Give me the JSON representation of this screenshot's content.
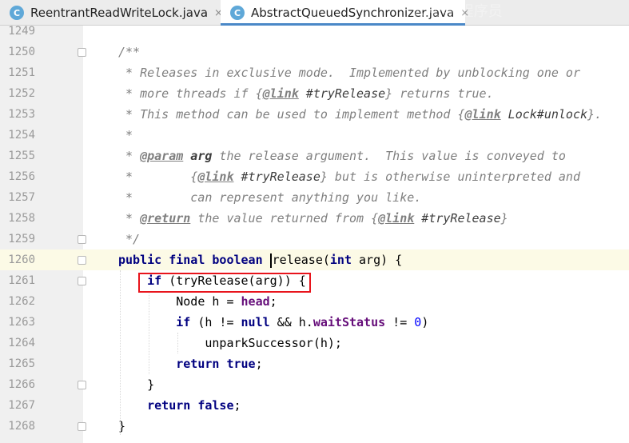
{
  "tabs": [
    {
      "icon": "C",
      "label": "ReentrantReadWriteLock.java",
      "close": "×"
    },
    {
      "icon": "C",
      "label": "AbstractQueuedSynchronizer.java",
      "close": "×"
    }
  ],
  "lines": {
    "n1249": "1249",
    "n1250": "1250",
    "n1251": "1251",
    "n1252": "1252",
    "n1253": "1253",
    "n1254": "1254",
    "n1255": "1255",
    "n1256": "1256",
    "n1257": "1257",
    "n1258": "1258",
    "n1259": "1259",
    "n1260": "1260",
    "n1261": "1261",
    "n1262": "1262",
    "n1263": "1263",
    "n1264": "1264",
    "n1265": "1265",
    "n1266": "1266",
    "n1267": "1267",
    "n1268": "1268"
  },
  "code": {
    "l1250": "/**",
    "l1251": " * Releases in exclusive mode.  Implemented by unblocking one or",
    "l1252_a": " * more threads if {",
    "l1252_tag": "@link",
    "l1252_ref": " #tryRelease",
    "l1252_b": "} returns true.",
    "l1253_a": " * This method can be used to implement method {",
    "l1253_tag": "@link",
    "l1253_ref": " Lock#unlock",
    "l1253_b": "}.",
    "l1254": " *",
    "l1255_a": " * ",
    "l1255_tag": "@param",
    "l1255_arg": " arg",
    "l1255_b": " the release argument.  This value is conveyed to",
    "l1256_a": " *        {",
    "l1256_tag": "@link",
    "l1256_ref": " #tryRelease",
    "l1256_b": "} but is otherwise uninterpreted and",
    "l1257": " *        can represent anything you like.",
    "l1258_a": " * ",
    "l1258_tag": "@return",
    "l1258_b": " the value returned from {",
    "l1258_tag2": "@link",
    "l1258_ref": " #tryRelease",
    "l1258_c": "}",
    "l1259": " */",
    "l1260_kw": "public final boolean ",
    "l1260_name": "release",
    "l1260_p": "(",
    "l1260_kw2": "int",
    "l1260_rest": " arg) {",
    "l1261_ind": "    ",
    "l1261_kw": "if",
    "l1261_rest": " (tryRelease(arg)) {",
    "l1262_a": "        Node h = ",
    "l1262_fld": "head",
    "l1262_b": ";",
    "l1263_ind": "        ",
    "l1263_kw": "if",
    "l1263_a": " (h != ",
    "l1263_kw2": "null",
    "l1263_b": " && h.",
    "l1263_fld": "waitStatus",
    "l1263_c": " != ",
    "l1263_num": "0",
    "l1263_d": ")",
    "l1264": "            unparkSuccessor(h);",
    "l1265_ind": "        ",
    "l1265_kw": "return",
    "l1265_sp": " ",
    "l1265_kw2": "true",
    "l1265_b": ";",
    "l1266": "    }",
    "l1267_ind": "    ",
    "l1267_kw": "return",
    "l1267_sp": " ",
    "l1267_kw2": "false",
    "l1267_b": ";",
    "l1268": "}"
  },
  "watermark": "公众号 程序员"
}
